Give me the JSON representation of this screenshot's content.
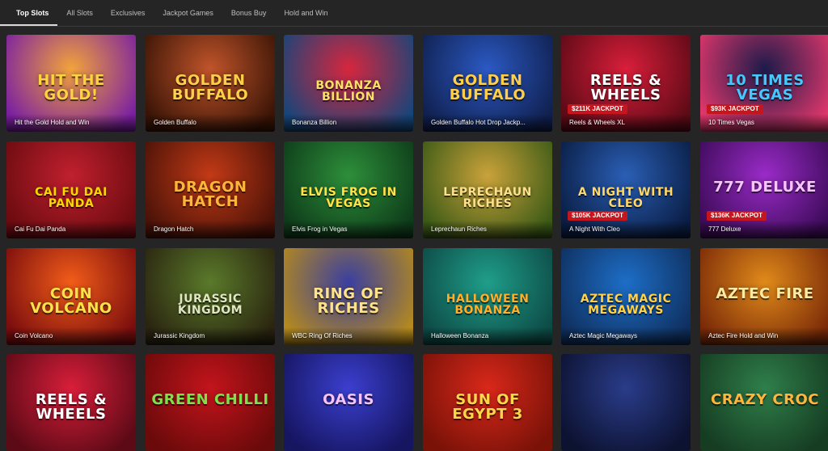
{
  "tabs": [
    {
      "label": "Top Slots",
      "active": true
    },
    {
      "label": "All Slots",
      "active": false
    },
    {
      "label": "Exclusives",
      "active": false
    },
    {
      "label": "Jackpot Games",
      "active": false
    },
    {
      "label": "Bonus Buy",
      "active": false
    },
    {
      "label": "Hold and Win",
      "active": false
    }
  ],
  "games": [
    {
      "title": "Hit the Gold Hold and Win",
      "logo": "HIT THE GOLD!",
      "jackpot": "",
      "bg": [
        "#f2a33b",
        "#7a1fa2"
      ],
      "logo_color": "#ffd23f"
    },
    {
      "title": "Golden Buffalo",
      "logo": "GOLDEN BUFFALO",
      "jackpot": "",
      "bg": [
        "#c0542a",
        "#3a1406"
      ],
      "logo_color": "#ffcf4a"
    },
    {
      "title": "Bonanza Billion",
      "logo": "BONANZA BILLION",
      "jackpot": "",
      "bg": [
        "#d7263d",
        "#16457a"
      ],
      "logo_color": "#ffe066"
    },
    {
      "title": "Golden Buffalo Hot Drop Jackp...",
      "logo": "GOLDEN BUFFALO",
      "jackpot": "",
      "bg": [
        "#2b59c3",
        "#10204f"
      ],
      "logo_color": "#ffcf4a"
    },
    {
      "title": "Reels & Wheels XL",
      "logo": "REELS & WHEELS",
      "jackpot": "$211K JACKPOT",
      "bg": [
        "#d91e3a",
        "#5c0a16"
      ],
      "logo_color": "#ffffff"
    },
    {
      "title": "10 Times Vegas",
      "logo": "10 TIMES VEGAS",
      "jackpot": "$93K JACKPOT",
      "bg": [
        "#1c1b4a",
        "#e0376b"
      ],
      "logo_color": "#46c8ff"
    },
    {
      "title": "Cai Fu Dai Panda",
      "logo": "CAI FU DAI PANDA",
      "jackpot": "",
      "bg": [
        "#c0202e",
        "#6b0b10"
      ],
      "logo_color": "#ffd700"
    },
    {
      "title": "Dragon Hatch",
      "logo": "DRAGON HATCH",
      "jackpot": "",
      "bg": [
        "#c33a16",
        "#4a1208"
      ],
      "logo_color": "#ffb43a"
    },
    {
      "title": "Elvis Frog in Vegas",
      "logo": "ELVIS FROG IN VEGAS",
      "jackpot": "",
      "bg": [
        "#2d8f3a",
        "#0e3b1a"
      ],
      "logo_color": "#ffe347"
    },
    {
      "title": "Leprechaun Riches",
      "logo": "LEPRECHAUN RICHES",
      "jackpot": "",
      "bg": [
        "#caa23a",
        "#3b5a16"
      ],
      "logo_color": "#ffe08a"
    },
    {
      "title": "A Night With Cleo",
      "logo": "A NIGHT WITH CLEO",
      "jackpot": "$105K JACKPOT",
      "bg": [
        "#2a5fb5",
        "#0a1d44"
      ],
      "logo_color": "#ffd86b"
    },
    {
      "title": "777 Deluxe",
      "logo": "777 DELUXE",
      "jackpot": "$136K JACKPOT",
      "bg": [
        "#9a2bc8",
        "#3d0b59"
      ],
      "logo_color": "#f8c4ff"
    },
    {
      "title": "Coin Volcano",
      "logo": "COIN VOLCANO",
      "jackpot": "",
      "bg": [
        "#f25c19",
        "#7a0d0d"
      ],
      "logo_color": "#ffe24a"
    },
    {
      "title": "Jurassic Kingdom",
      "logo": "JURASSIC KINGDOM",
      "jackpot": "",
      "bg": [
        "#5a7a2a",
        "#2a2410"
      ],
      "logo_color": "#dfe6c0"
    },
    {
      "title": "WBC Ring Of Riches",
      "logo": "RING OF RICHES",
      "jackpot": "",
      "bg": [
        "#3a3fa0",
        "#b58a1d"
      ],
      "logo_color": "#ffe38a"
    },
    {
      "title": "Halloween Bonanza",
      "logo": "HALLOWEEN BONANZA",
      "jackpot": "",
      "bg": [
        "#1f9e8a",
        "#0d4a45"
      ],
      "logo_color": "#ffb028"
    },
    {
      "title": "Aztec Magic Megaways",
      "logo": "AZTEC MAGIC MEGAWAYS",
      "jackpot": "",
      "bg": [
        "#1d6ec7",
        "#0f2f5e"
      ],
      "logo_color": "#ffd24a"
    },
    {
      "title": "Aztec Fire Hold and Win",
      "logo": "AZTEC FIRE",
      "jackpot": "",
      "bg": [
        "#e08a1a",
        "#7a2a08"
      ],
      "logo_color": "#ffeaa0"
    },
    {
      "title": "",
      "logo": "REELS & WHEELS",
      "jackpot": "",
      "bg": [
        "#d91e3a",
        "#5c0a16"
      ],
      "logo_color": "#ffffff"
    },
    {
      "title": "",
      "logo": "GREEN CHILLI",
      "jackpot": "",
      "bg": [
        "#c3141c",
        "#6b0a0a"
      ],
      "logo_color": "#7ee04a"
    },
    {
      "title": "",
      "logo": "OASIS",
      "jackpot": "",
      "bg": [
        "#3b3fcf",
        "#151560"
      ],
      "logo_color": "#f6c2ff"
    },
    {
      "title": "",
      "logo": "SUN OF EGYPT 3",
      "jackpot": "",
      "bg": [
        "#d9281a",
        "#7a1208"
      ],
      "logo_color": "#ffd64a"
    },
    {
      "title": "",
      "logo": "",
      "jackpot": "",
      "bg": [
        "#2a3c8a",
        "#0c1230"
      ],
      "logo_color": "#9ad7ff"
    },
    {
      "title": "",
      "logo": "CRAZY CROC",
      "jackpot": "",
      "bg": [
        "#2f7f4a",
        "#163c22"
      ],
      "logo_color": "#ffb43a"
    }
  ]
}
